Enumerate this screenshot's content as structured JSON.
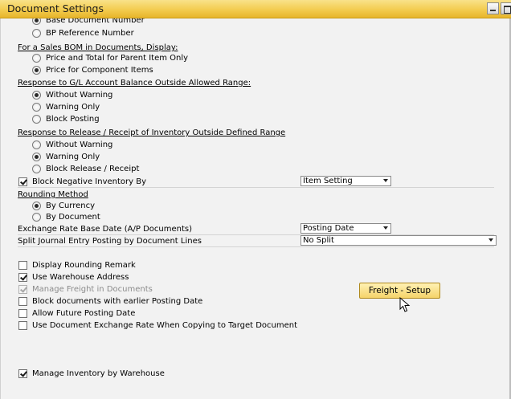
{
  "window": {
    "title": "Document Settings"
  },
  "top": {
    "partial_label": "Base Document Number",
    "bp_reference_label": "BP Reference Number"
  },
  "sales_bom": {
    "header": "For a Sales BOM in Documents, Display:",
    "options": [
      "Price and Total for Parent Item Only",
      "Price for Component Items"
    ],
    "selected": "Price for Component Items"
  },
  "gl_balance": {
    "header": "Response to G/L Account Balance Outside Allowed Range:",
    "options": [
      "Without Warning",
      "Warning Only",
      "Block Posting"
    ],
    "selected": "Without Warning"
  },
  "release_receipt": {
    "header": "Response to Release / Receipt of Inventory Outside Defined Range",
    "options": [
      "Without Warning",
      "Warning Only",
      "Block Release / Receipt"
    ],
    "selected": "Warning Only"
  },
  "block_negative": {
    "label": "Block Negative Inventory By",
    "checked": true,
    "select_value": "Item Setting"
  },
  "rounding": {
    "header": "Rounding Method",
    "options": [
      "By Currency",
      "By Document"
    ],
    "selected": "By Currency"
  },
  "exchange_rate": {
    "label": "Exchange Rate Base Date (A/P Documents)",
    "select_value": "Posting Date"
  },
  "split_journal": {
    "label": "Split Journal Entry Posting by Document Lines",
    "select_value": "No Split"
  },
  "checkboxes": {
    "display_rounding": {
      "label": "Display Rounding Remark",
      "checked": false
    },
    "use_warehouse": {
      "label": "Use Warehouse Address",
      "checked": true
    },
    "manage_freight": {
      "label": "Manage Freight in Documents",
      "checked": true,
      "disabled": true
    },
    "block_earlier": {
      "label": "Block documents with earlier Posting Date",
      "checked": false
    },
    "allow_future": {
      "label": "Allow Future Posting Date",
      "checked": false
    },
    "use_doc_rate": {
      "label": "Use Document Exchange Rate When Copying to Target Document",
      "checked": false
    },
    "manage_inventory": {
      "label": "Manage Inventory by Warehouse",
      "checked": true
    }
  },
  "freight_button": {
    "label": "Freight - Setup"
  },
  "colors": {
    "title_bar": "#f3cc4f",
    "button": "#f5d36a",
    "background": "#f2f2f2"
  }
}
